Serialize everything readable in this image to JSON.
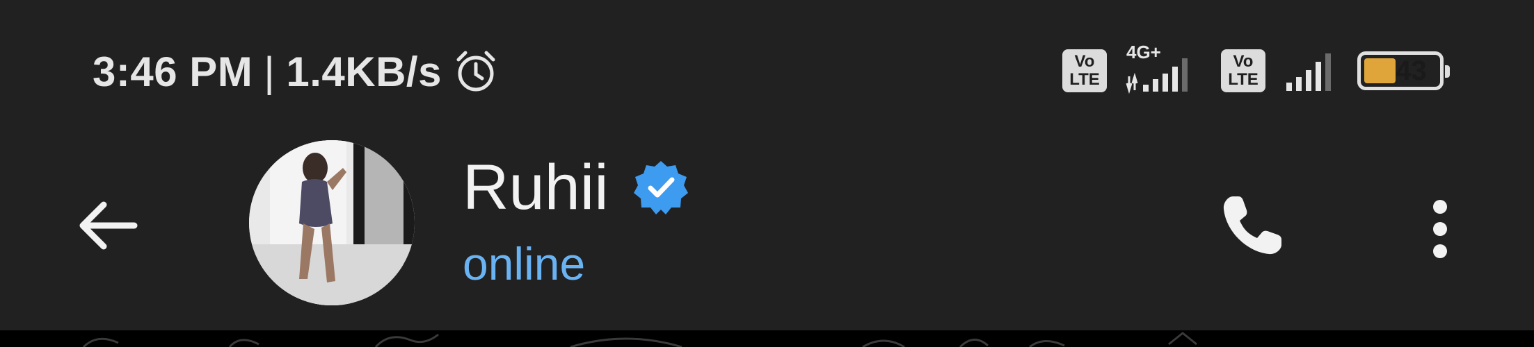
{
  "status_bar": {
    "time": "3:46 PM",
    "separator": "|",
    "net_speed": "1.4KB/s",
    "alarm_icon": "alarm-clock-icon",
    "volte_1": "Vo\nLTE",
    "volte_1_top": "Vo",
    "volte_1_bottom": "LTE",
    "network_type": "4G+",
    "volte_2_top": "Vo",
    "volte_2_bottom": "LTE",
    "battery_level": "43",
    "battery_fraction": 0.43
  },
  "header": {
    "back_icon": "arrow-left-icon",
    "contact_name": "Ruhii",
    "verified_icon": "verified-badge-icon",
    "contact_status": "online",
    "call_icon": "phone-icon",
    "menu_icon": "more-vertical-icon"
  },
  "colors": {
    "background": "#212122",
    "status_online": "#6ab3f3",
    "verified_badge": "#3d9bf0",
    "battery_fill": "#e0a53a",
    "text_primary": "#f2f2f2"
  }
}
